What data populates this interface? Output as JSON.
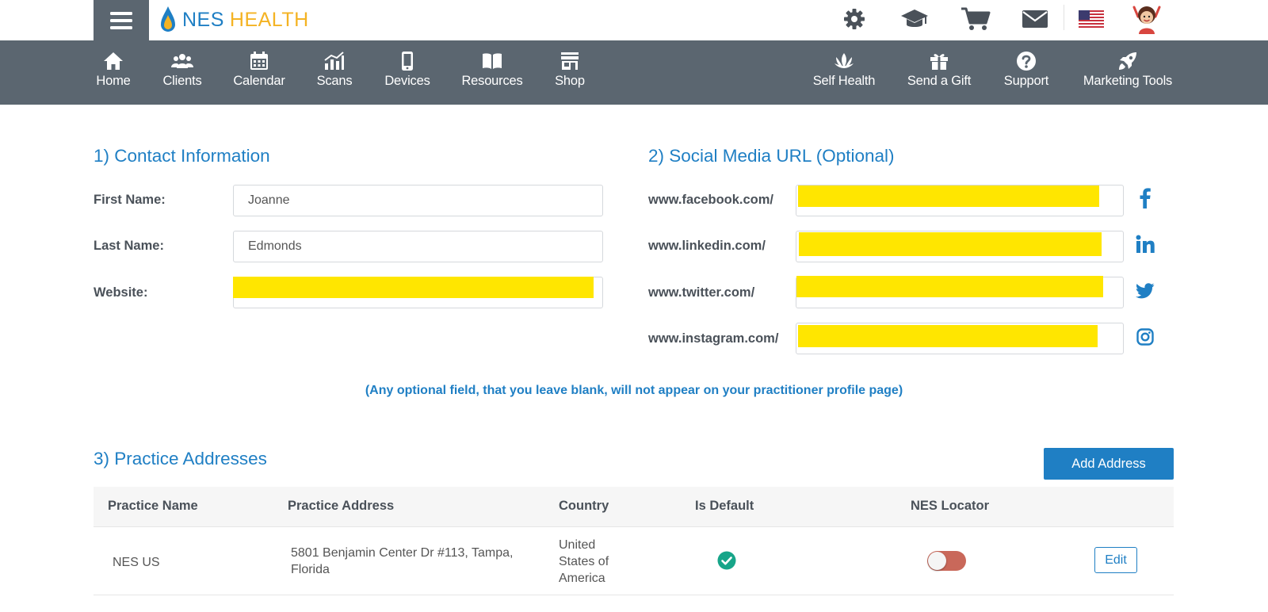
{
  "brand": {
    "part1": "NES",
    "part2": "HEALTH"
  },
  "top_icons": [
    "gear-icon",
    "graduation-cap-icon",
    "shopping-cart-icon",
    "envelope-icon",
    "us-flag-icon",
    "avatar"
  ],
  "nav": {
    "left": [
      {
        "label": "Home",
        "icon": "home-icon"
      },
      {
        "label": "Clients",
        "icon": "users-icon"
      },
      {
        "label": "Calendar",
        "icon": "calendar-icon"
      },
      {
        "label": "Scans",
        "icon": "bar-chart-icon"
      },
      {
        "label": "Devices",
        "icon": "mobile-icon"
      },
      {
        "label": "Resources",
        "icon": "book-icon"
      },
      {
        "label": "Shop",
        "icon": "store-icon"
      }
    ],
    "right": [
      {
        "label": "Self Health",
        "icon": "lotus-icon"
      },
      {
        "label": "Send a Gift",
        "icon": "gift-icon"
      },
      {
        "label": "Support",
        "icon": "question-icon"
      },
      {
        "label": "Marketing Tools",
        "icon": "rocket-icon"
      }
    ]
  },
  "contact": {
    "title": "1) Contact Information",
    "first_name_label": "First Name:",
    "first_name_value": "Joanne",
    "last_name_label": "Last Name:",
    "last_name_value": "Edmonds",
    "website_label": "Website:"
  },
  "social": {
    "title": "2) Social Media URL (Optional)",
    "facebook_label": "www.facebook.com/",
    "linkedin_label": "www.linkedin.com/",
    "twitter_label": "www.twitter.com/",
    "instagram_label": "www.instagram.com/"
  },
  "hint": "(Any optional field, that you leave blank, will not appear on your practitioner profile page)",
  "addresses": {
    "title": "3) Practice Addresses",
    "add_button": "Add Address",
    "columns": [
      "Practice Name",
      "Practice Address",
      "Country",
      "Is Default",
      "NES Locator"
    ],
    "rows": [
      {
        "name": "NES US",
        "address": "5801 Benjamin Center Dr #113, Tampa, Florida",
        "country": "United States of America",
        "is_default": true,
        "nes_locator": false,
        "edit_label": "Edit"
      }
    ]
  },
  "colors": {
    "accent": "#1f7fc4",
    "nav_bg": "#5b6670",
    "brand_yellow": "#f4b323",
    "redaction": "#ffe600",
    "check_green": "#17a589",
    "toggle_off": "#c9685a"
  }
}
